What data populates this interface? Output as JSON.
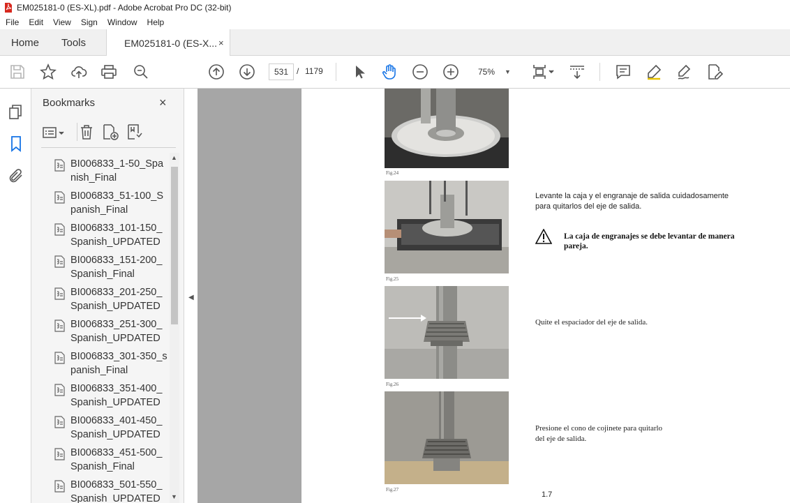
{
  "window": {
    "title": "EM025181-0 (ES-XL).pdf - Adobe Acrobat Pro DC (32-bit)"
  },
  "menu": [
    "File",
    "Edit",
    "View",
    "Sign",
    "Window",
    "Help"
  ],
  "tabs": {
    "home": "Home",
    "tools": "Tools",
    "document": "EM025181-0 (ES-X...",
    "close_glyph": "×"
  },
  "toolbar": {
    "current_page": "531",
    "page_separator": "/",
    "total_pages": "1179",
    "zoom": "75%"
  },
  "bookmarks": {
    "title": "Bookmarks",
    "close_glyph": "×",
    "items": [
      "BI006833_1-50_Spanish_Final",
      "BI006833_51-100_Spanish_Final",
      "BI006833_101-150_Spanish_UPDATED",
      "BI006833_151-200_Spanish_Final",
      "BI006833_201-250_Spanish_UPDATED",
      "BI006833_251-300_Spanish_UPDATED",
      "BI006833_301-350_spanish_Final",
      "BI006833_351-400_Spanish_UPDATED",
      "BI006833_401-450_Spanish_UPDATED",
      "BI006833_451-500_Spanish_Final",
      "BI006833_501-550_Spanish_UPDATED"
    ]
  },
  "document": {
    "figures": [
      {
        "caption": "Fig.24"
      },
      {
        "caption": "Fig.25"
      },
      {
        "caption": "Fig.26"
      },
      {
        "caption": "Fig.27"
      }
    ],
    "step25": {
      "line1": "Levante la caja y el engranaje de salida cuidadosamente",
      "line2": "para quitarlos del eje de salida."
    },
    "warning": {
      "line1": "La caja de engranajes se debe levantar de manera",
      "line2": "pareja."
    },
    "step26": "Quite el espaciador del eje de salida.",
    "step27": {
      "line1": "Presione el cono de cojinete para quitarlo",
      "line2": "del eje de salida."
    },
    "page_number": "1.7"
  }
}
